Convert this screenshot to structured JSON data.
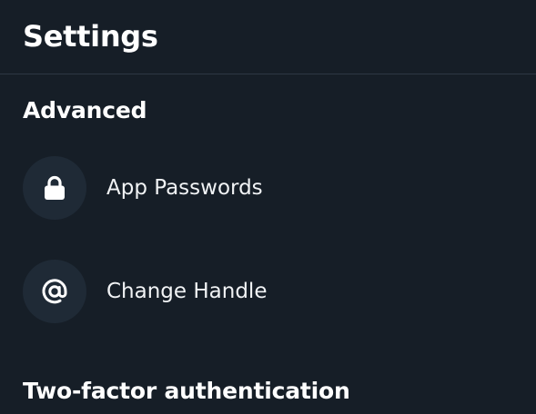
{
  "header": {
    "title": "Settings"
  },
  "sections": [
    {
      "heading": "Advanced",
      "items": [
        {
          "label": "App Passwords",
          "icon": "lock-icon"
        },
        {
          "label": "Change Handle",
          "icon": "at-sign-icon"
        }
      ]
    },
    {
      "heading": "Two-factor authentication"
    }
  ],
  "colors": {
    "background": "#161e27",
    "divider": "#2e3843",
    "icon_circle": "#1f2a36",
    "text": "#ffffff"
  }
}
